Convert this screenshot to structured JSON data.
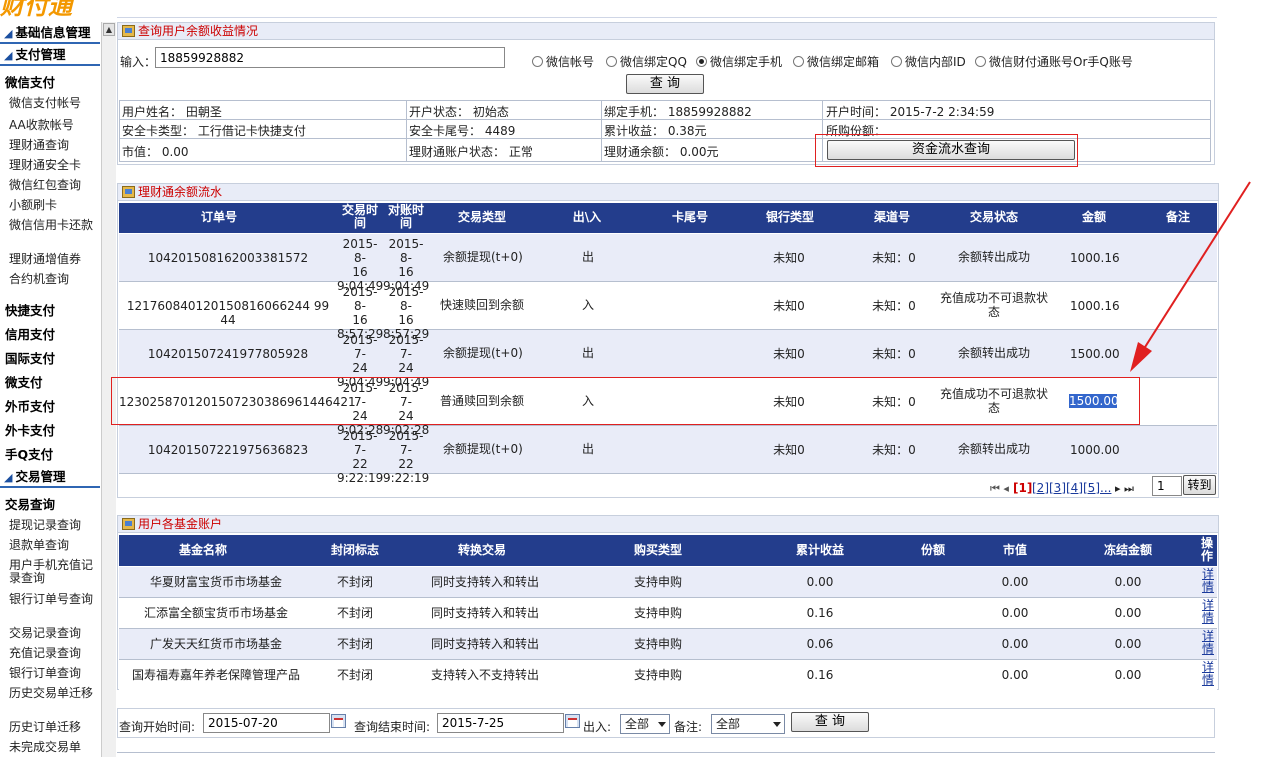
{
  "sidebar": {
    "sections": [
      {
        "label": "基础信息管理"
      },
      {
        "label": "支付管理"
      },
      {
        "label": "交易管理"
      }
    ],
    "pay_groups": [
      {
        "label": "微信支付"
      },
      {
        "label": "快捷支付"
      },
      {
        "label": "信用支付"
      },
      {
        "label": "国际支付"
      },
      {
        "label": "微支付"
      },
      {
        "label": "外币支付"
      },
      {
        "label": "外卡支付"
      },
      {
        "label": "手Q支付"
      }
    ],
    "wechat_items": [
      "微信支付帐号",
      "AA收款帐号",
      "理财通查询",
      "理财通安全卡",
      "微信红包查询",
      "小额刷卡",
      "微信信用卡还款",
      "理财通增值券",
      "合约机查询"
    ],
    "trade_group": "交易查询",
    "trade_items": [
      "提现记录查询",
      "退款单查询",
      "用户手机充值记录查询",
      "银行订单号查询",
      "交易记录查询",
      "充值记录查询",
      "银行订单查询",
      "历史交易单迁移",
      "历史订单迁移",
      "未完成交易单"
    ]
  },
  "query_panel": {
    "title": "查询用户余额收益情况",
    "input_label": "输入：",
    "input_value": "18859928882",
    "radios": [
      {
        "label": "微信帐号",
        "checked": false
      },
      {
        "label": "微信绑定QQ",
        "checked": false
      },
      {
        "label": "微信绑定手机",
        "checked": true
      },
      {
        "label": "微信绑定邮箱",
        "checked": false
      },
      {
        "label": "微信内部ID",
        "checked": false
      },
      {
        "label": "微信财付通账号Or手Q账号",
        "checked": false
      }
    ],
    "query_button": "查 询",
    "info": {
      "user_name": "用户姓名：  田朝圣",
      "open_status": "开户状态：  初始态",
      "bind_phone": "绑定手机：  18859928882",
      "open_time": "开户时间：  2015-7-2 2:34:59",
      "card_type": "安全卡类型：  工行借记卡快捷支付",
      "card_tail": "安全卡尾号：  4489",
      "total_income": "累计收益：  0.38元",
      "share": "所购份额：",
      "market_value": "市值：   0.00",
      "account_status": "理财通账户状态：  正常",
      "balance": "理财通余额：  0.00元",
      "flow_button": "资金流水查询"
    }
  },
  "flow_panel": {
    "title": "理财通余额流水",
    "headers": [
      "订单号",
      "交易时间",
      "对账时间",
      "交易类型",
      "出\\入",
      "卡尾号",
      "银行类型",
      "渠道号",
      "交易状态",
      "金额",
      "备注"
    ],
    "rows": [
      {
        "order": "104201508162003381572",
        "t1a": "2015-8-",
        "t1b": "16",
        "t1c": "9:04:49",
        "t2a": "2015-8-",
        "t2b": "16",
        "t2c": "9:04:49",
        "type": "余额提现(t+0)",
        "io": "出",
        "bank": "未知0",
        "channel": "未知：0",
        "status": "余额转出成功",
        "amount": "1000.16"
      },
      {
        "order": "12176084012015081606624499 44",
        "t1a": "2015-8-",
        "t1b": "16",
        "t1c": "8:57:29",
        "t2a": "2015-8-",
        "t2b": "16",
        "t2c": "8:57:29",
        "type": "快速赎回到余额",
        "io": "入",
        "bank": "未知0",
        "channel": "未知：0",
        "status": "充值成功不可退款状态",
        "amount": "1000.16"
      },
      {
        "order": "104201507241977805928",
        "t1a": "2015-7-",
        "t1b": "24",
        "t1c": "9:04:49",
        "t2a": "2015-7-",
        "t2b": "24",
        "t2c": "9:04:49",
        "type": "余额提现(t+0)",
        "io": "出",
        "bank": "未知0",
        "channel": "未知：0",
        "status": "余额转出成功",
        "amount": "1500.00"
      },
      {
        "order": "1230258701201507230386961446421",
        "t1a": "2015-7-",
        "t1b": "24",
        "t1c": "9:02:28",
        "t2a": "2015-7-",
        "t2b": "24",
        "t2c": "9:02:28",
        "type": "普通赎回到余额",
        "io": "入",
        "bank": "未知0",
        "channel": "未知：0",
        "status": "充值成功不可退款状态",
        "amount": "1500.00"
      },
      {
        "order": "104201507221975636823",
        "t1a": "2015-7-",
        "t1b": "22",
        "t1c": "9:22:19",
        "t2a": "2015-7-",
        "t2b": "22",
        "t2c": "9:22:19",
        "type": "余额提现(t+0)",
        "io": "出",
        "bank": "未知0",
        "channel": "未知：0",
        "status": "余额转出成功",
        "amount": "1000.00"
      }
    ],
    "pager": {
      "current": "[1]",
      "pages": [
        "[2]",
        "[3]",
        "[4]",
        "[5]..."
      ],
      "page_input": "1",
      "go_button": "转到"
    }
  },
  "fund_panel": {
    "title": "用户各基金账户",
    "headers": [
      "基金名称",
      "封闭标志",
      "转换交易",
      "购买类型",
      "累计收益",
      "份额",
      "市值",
      "冻结金额",
      "操作"
    ],
    "rows": [
      {
        "name": "华夏财富宝货币市场基金",
        "closed": "不封闭",
        "convert": "同时支持转入和转出",
        "buy": "支持申购",
        "income": "0.00",
        "share": "",
        "market": "0.00",
        "frozen": "0.00",
        "op": "详情"
      },
      {
        "name": "汇添富全额宝货币市场基金",
        "closed": "不封闭",
        "convert": "同时支持转入和转出",
        "buy": "支持申购",
        "income": "0.16",
        "share": "",
        "market": "0.00",
        "frozen": "0.00",
        "op": "详情"
      },
      {
        "name": "广发天天红货币市场基金",
        "closed": "不封闭",
        "convert": "同时支持转入和转出",
        "buy": "支持申购",
        "income": "0.06",
        "share": "",
        "market": "0.00",
        "frozen": "0.00",
        "op": "详情"
      },
      {
        "name": "国寿福寿嘉年养老保障管理产品",
        "closed": "不封闭",
        "convert": "支持转入不支持转出",
        "buy": "支持申购",
        "income": "0.16",
        "share": "",
        "market": "0.00",
        "frozen": "0.00",
        "op": "详情"
      }
    ]
  },
  "filter_bar": {
    "start_label": "查询开始时间:",
    "start_value": "2015-07-20",
    "end_label": "查询结束时间:",
    "end_value": "2015-7-25",
    "io_label": "出入:",
    "io_value": "全部",
    "remark_label": "备注:",
    "remark_value": "全部",
    "query_button": "查 询"
  },
  "colors": {
    "header_bg": "#233d8c",
    "alt_row": "#e9ecf8",
    "title_red": "#cc0000",
    "annotation_red": "#e02020"
  }
}
